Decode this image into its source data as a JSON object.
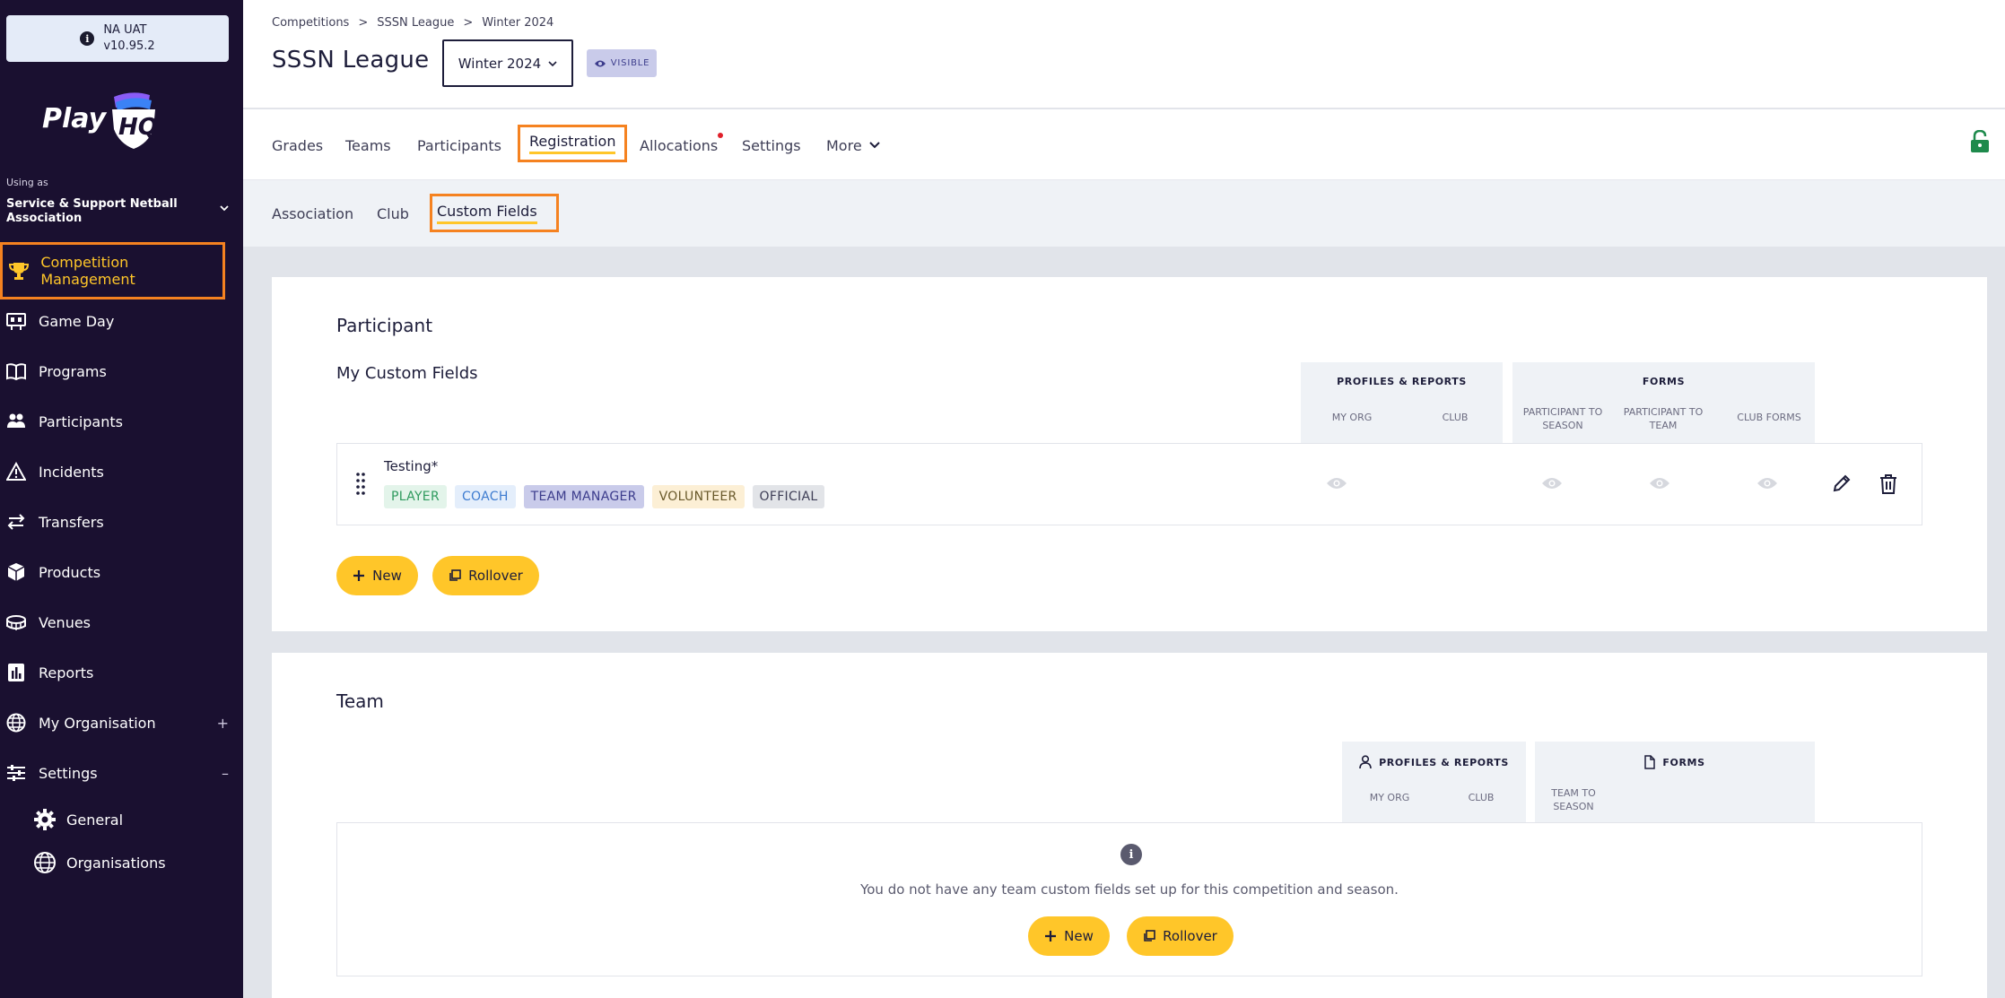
{
  "app": {
    "env_name": "NA UAT",
    "env_version": "v10.95.2",
    "logo_text": "PlayHQ"
  },
  "sidebar": {
    "using_as_label": "Using as",
    "org_name": "Service & Support Netball Association",
    "items": [
      {
        "label": "Competition Management",
        "icon": "trophy-icon",
        "active": true
      },
      {
        "label": "Game Day",
        "icon": "scoreboard-icon"
      },
      {
        "label": "Programs",
        "icon": "book-icon"
      },
      {
        "label": "Participants",
        "icon": "people-icon"
      },
      {
        "label": "Incidents",
        "icon": "warning-icon"
      },
      {
        "label": "Transfers",
        "icon": "transfer-arrows-icon"
      },
      {
        "label": "Products",
        "icon": "box-icon"
      },
      {
        "label": "Venues",
        "icon": "stadium-icon"
      },
      {
        "label": "Reports",
        "icon": "report-icon"
      },
      {
        "label": "My Organisation",
        "icon": "globe-icon",
        "expander": "+"
      },
      {
        "label": "Settings",
        "icon": "sliders-icon",
        "expander": "–"
      }
    ],
    "sub_items": [
      {
        "label": "General",
        "icon": "gear-icon"
      },
      {
        "label": "Organisations",
        "icon": "globe-icon"
      }
    ]
  },
  "header": {
    "breadcrumb": [
      "Competitions",
      ">",
      "SSSN League",
      ">",
      "Winter 2024"
    ],
    "title": "SSSN League",
    "season_selected": "Winter 2024",
    "visibility_badge": "VISIBLE"
  },
  "tabs": [
    {
      "label": "Grades"
    },
    {
      "label": "Teams"
    },
    {
      "label": "Participants"
    },
    {
      "label": "Registration",
      "active": true
    },
    {
      "label": "Allocations",
      "notification": true
    },
    {
      "label": "Settings"
    },
    {
      "label": "More"
    }
  ],
  "subtabs": [
    {
      "label": "Association"
    },
    {
      "label": "Club"
    },
    {
      "label": "Custom Fields",
      "active": true
    }
  ],
  "participant_section": {
    "title": "Participant",
    "subtitle": "My Custom Fields",
    "profiles_group": {
      "title": "PROFILES & REPORTS",
      "cols": [
        "MY ORG",
        "CLUB"
      ]
    },
    "forms_group": {
      "title": "FORMS",
      "cols": [
        "PARTICIPANT TO SEASON",
        "PARTICIPANT TO TEAM",
        "CLUB FORMS"
      ]
    },
    "fields": [
      {
        "name": "Testing",
        "required_mark": "*",
        "tags": [
          "PLAYER",
          "COACH",
          "TEAM MANAGER",
          "VOLUNTEER",
          "OFFICIAL"
        ]
      }
    ],
    "new_button": "New",
    "rollover_button": "Rollover"
  },
  "team_section": {
    "title": "Team",
    "profiles_group": {
      "title": "PROFILES & REPORTS",
      "cols": [
        "MY ORG",
        "CLUB"
      ]
    },
    "forms_group": {
      "title": "FORMS",
      "cols": [
        "TEAM TO SEASON"
      ]
    },
    "empty_message": "You do not have any team custom fields set up for this competition and season.",
    "new_button": "New",
    "rollover_button": "Rollover"
  },
  "colors": {
    "sidebar_bg": "#1a1030",
    "accent_yellow": "#ffc629",
    "highlight_orange": "#f58220",
    "lock_green": "#1e8a4c"
  }
}
